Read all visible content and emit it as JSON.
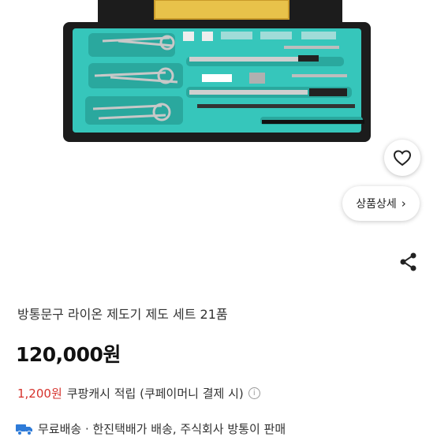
{
  "product": {
    "title": "방통문구 라이온 제도기 제도 세트 21품",
    "price": "120,000원",
    "cashback_amount": "1,200원",
    "cashback_text": "쿠팡캐시 적립 (쿠페이머니 결제 시)",
    "info_icon": "info-icon",
    "shipping_text": "무료배송 · 한진택배가 배송, 주식회사 방통이 판매"
  },
  "buttons": {
    "detail_label": "상품상세",
    "wishlist_icon": "heart-icon",
    "share_icon": "share-icon"
  },
  "colors": {
    "case_teal": "#36c6bb",
    "case_frame": "#1c1c1c",
    "cashback_red": "#d6322c",
    "truck_blue": "#2e7bd8"
  }
}
